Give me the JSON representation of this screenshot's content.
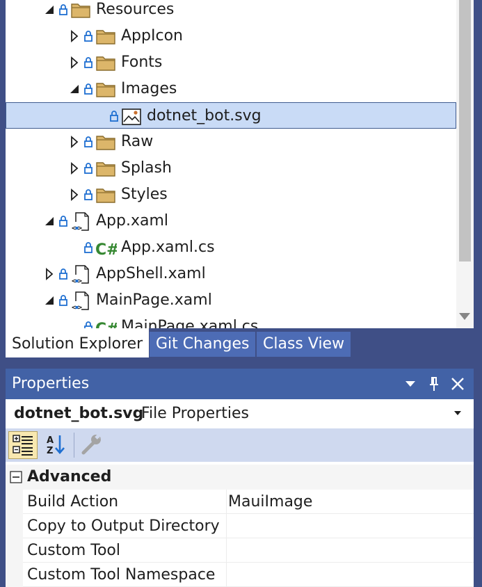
{
  "solution_explorer": {
    "tree": [
      {
        "label": "Resources",
        "icon": "folder-icon",
        "expander": "expanded",
        "lock": true
      },
      {
        "label": "AppIcon",
        "icon": "folder-icon",
        "expander": "collapsed",
        "lock": true
      },
      {
        "label": "Fonts",
        "icon": "folder-icon",
        "expander": "collapsed",
        "lock": true
      },
      {
        "label": "Images",
        "icon": "folder-icon",
        "expander": "expanded",
        "lock": true
      },
      {
        "label": "dotnet_bot.svg",
        "icon": "image-file-icon",
        "expander": "none",
        "lock": true,
        "selected": true
      },
      {
        "label": "Raw",
        "icon": "folder-icon",
        "expander": "collapsed",
        "lock": true
      },
      {
        "label": "Splash",
        "icon": "folder-icon",
        "expander": "collapsed",
        "lock": true
      },
      {
        "label": "Styles",
        "icon": "folder-icon",
        "expander": "collapsed",
        "lock": true
      },
      {
        "label": "App.xaml",
        "icon": "xaml-file-icon",
        "expander": "expanded",
        "lock": true
      },
      {
        "label": "App.xaml.cs",
        "icon": "csharp-file-icon",
        "expander": "none",
        "lock": true
      },
      {
        "label": "AppShell.xaml",
        "icon": "xaml-file-icon",
        "expander": "collapsed",
        "lock": true
      },
      {
        "label": "MainPage.xaml",
        "icon": "xaml-file-icon",
        "expander": "expanded",
        "lock": true
      },
      {
        "label": "MainPage.xaml.cs",
        "icon": "csharp-file-icon",
        "expander": "none",
        "lock": true
      }
    ]
  },
  "tabs": [
    {
      "label": "Solution Explorer",
      "active": true
    },
    {
      "label": "Git Changes",
      "active": false
    },
    {
      "label": "Class View",
      "active": false
    }
  ],
  "properties": {
    "title": "Properties",
    "object_name": "dotnet_bot.svg",
    "object_type": "File Properties",
    "toolbar": {
      "categorized": "categorized-icon",
      "alphabetical": "alphabetical-sort-icon",
      "property_pages": "wrench-icon"
    },
    "category": "Advanced",
    "rows": [
      {
        "name": "Build Action",
        "value": "MauiImage"
      },
      {
        "name": "Copy to Output Directory",
        "value": ""
      },
      {
        "name": "Custom Tool",
        "value": ""
      },
      {
        "name": "Custom Tool Namespace",
        "value": ""
      }
    ]
  },
  "colors": {
    "frame": "#3f4f86",
    "title_bar": "#4262a6",
    "selection": "#c9dbf6",
    "folder": "#dcb66a",
    "lock_blue": "#1f6fd1",
    "csharp_green": "#368832"
  }
}
